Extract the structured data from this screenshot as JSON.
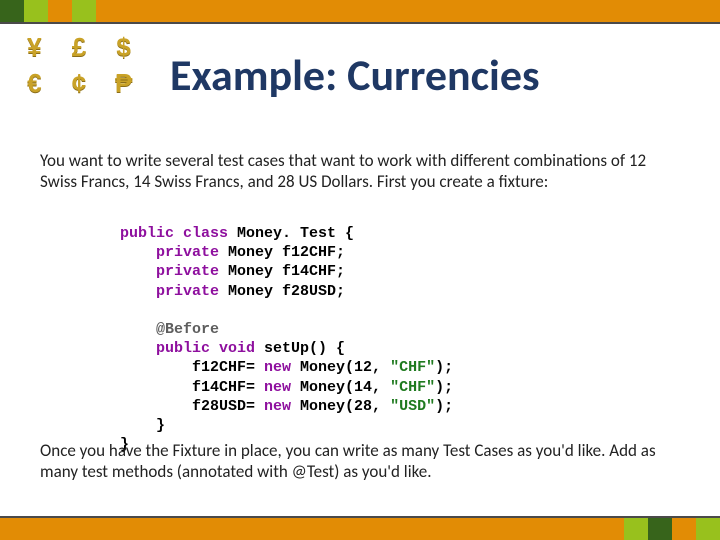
{
  "title": "Example: Currencies",
  "icons": [
    "¥",
    "£",
    "$",
    "€",
    "¢",
    "₱"
  ],
  "intro": "You want to write several test cases that want to work with different combinations of 12 Swiss Francs, 14 Swiss Francs, and 28 US Dollars. First you create a fixture:",
  "outro": "Once you have the Fixture in place, you can write as many Test Cases as you'd like. Add as many test methods (annotated with @Test) as you'd like.",
  "code": {
    "l1": {
      "kw": "public class",
      "rest": " Money. Test {"
    },
    "l2": {
      "kw": "private",
      "type": " Money",
      "name": " f12CHF;"
    },
    "l3": {
      "kw": "private",
      "type": " Money",
      "name": " f14CHF;"
    },
    "l4": {
      "kw": "private",
      "type": " Money",
      "name": " f28USD;"
    },
    "l5": {
      "ann": "@Before"
    },
    "l6": {
      "kw": "public void",
      "rest": " setUp() {"
    },
    "l7": {
      "lhs": "f12CHF= ",
      "kw": "new",
      "mid": " Money(12, ",
      "str": "\"CHF\"",
      "end": ");"
    },
    "l8": {
      "lhs": "f14CHF= ",
      "kw": "new",
      "mid": " Money(14, ",
      "str": "\"CHF\"",
      "end": ");"
    },
    "l9": {
      "lhs": "f28USD= ",
      "kw": "new",
      "mid": " Money(28, ",
      "str": "\"USD\"",
      "end": ");"
    },
    "l10": "}",
    "l11": "}"
  }
}
